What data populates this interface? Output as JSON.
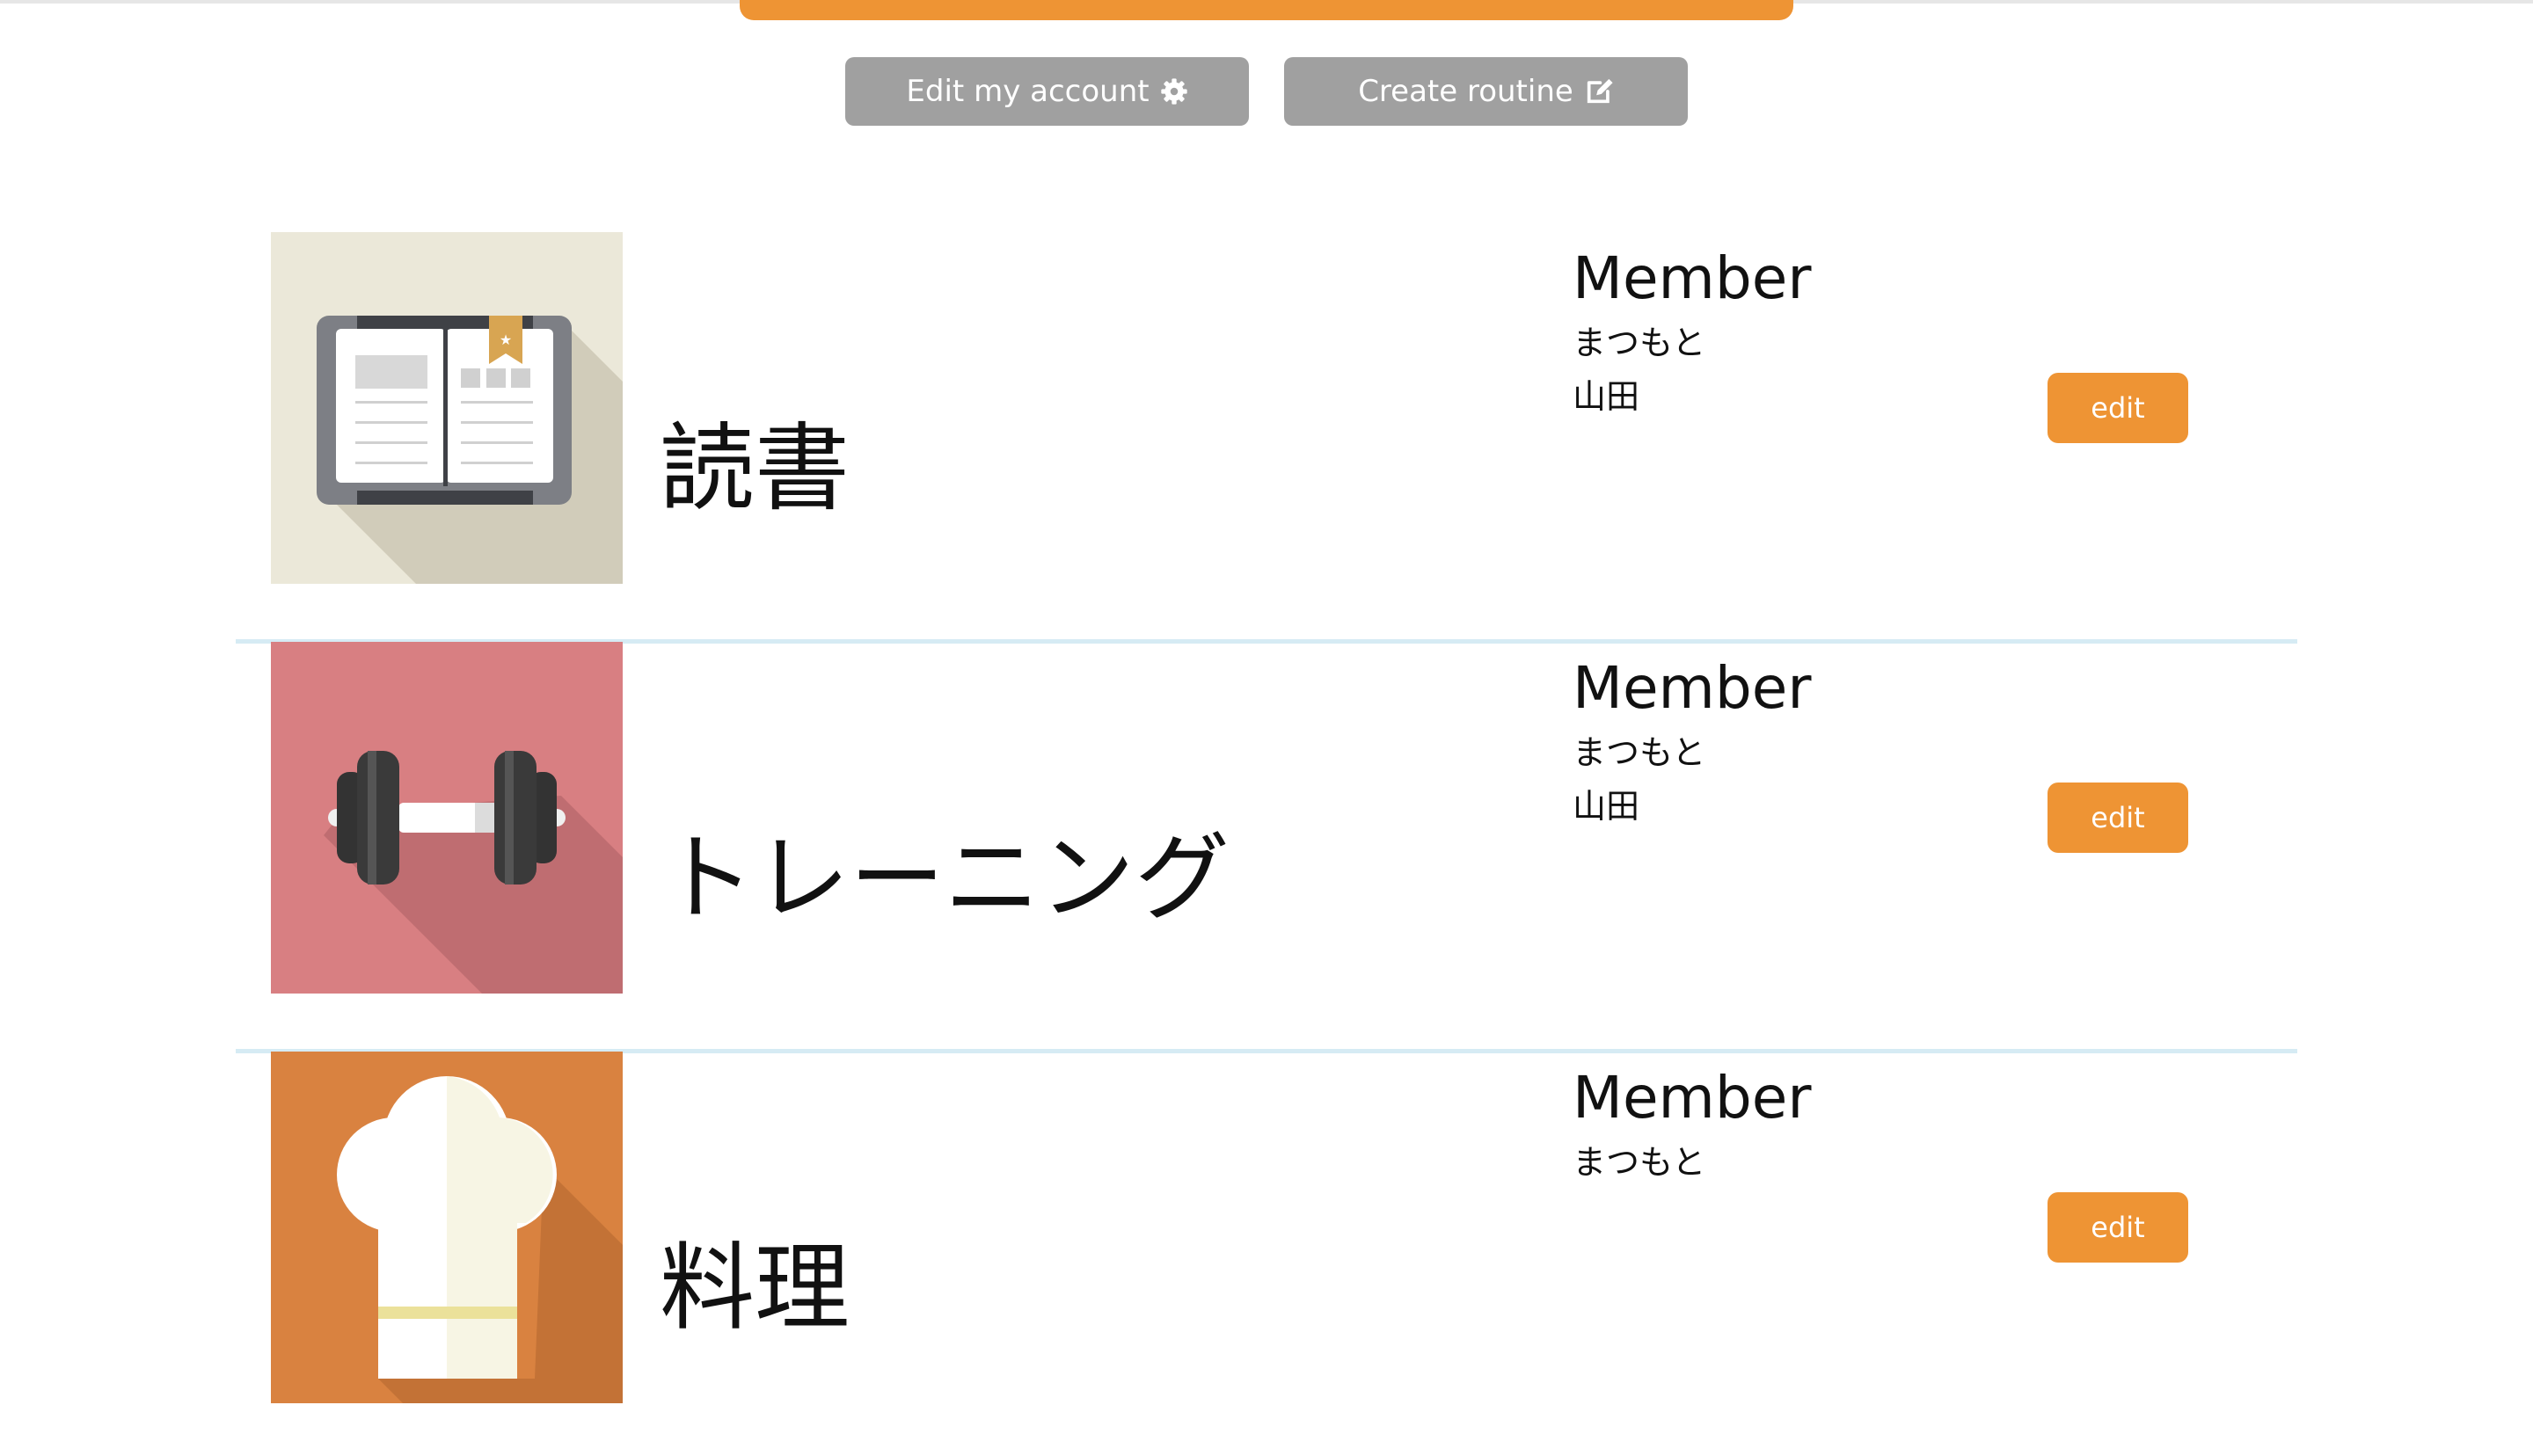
{
  "header": {
    "edit_account_label": "Edit my account",
    "edit_account_icon": "gear-icon",
    "create_routine_label": "Create routine",
    "create_routine_icon": "edit-square-icon"
  },
  "routines": [
    {
      "title": "読書",
      "icon": "book-icon",
      "members_heading": "Member",
      "members": [
        "まつもと",
        "山田"
      ],
      "edit_label": "edit"
    },
    {
      "title": "トレーニング",
      "icon": "dumbbell-icon",
      "members_heading": "Member",
      "members": [
        "まつもと",
        "山田"
      ],
      "edit_label": "edit"
    },
    {
      "title": "料理",
      "icon": "chef-hat-icon",
      "members_heading": "Member",
      "members": [
        "まつもと"
      ],
      "edit_label": "edit"
    }
  ],
  "colors": {
    "accent": "#ee9434",
    "button_gray": "#a0a0a0",
    "divider": "#d6ebf4"
  }
}
